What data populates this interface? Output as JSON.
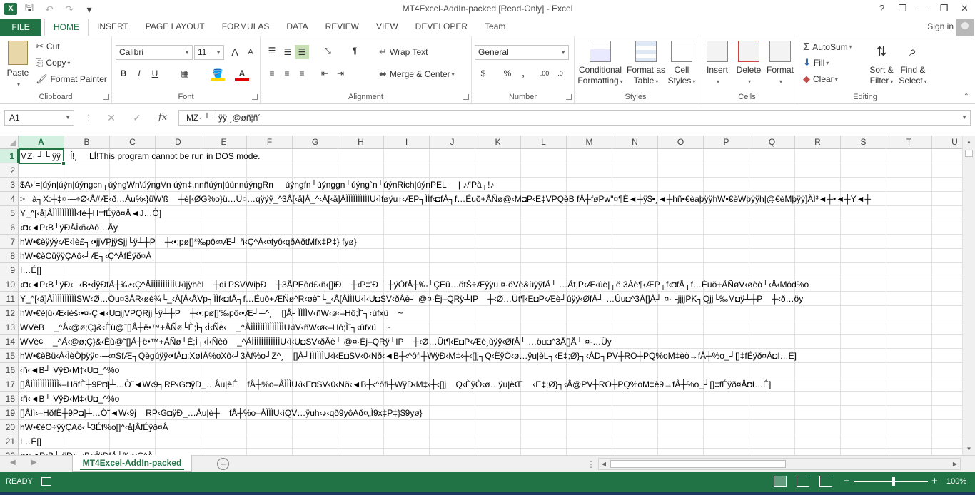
{
  "app": {
    "title": "MT4Excel-AddIn-packed  [Read-Only] - Excel",
    "logo": "X",
    "quick_access": [
      "save-icon",
      "undo-icon",
      "redo-icon",
      "customize-qat-icon"
    ],
    "window_controls": [
      "?",
      "❐",
      "—",
      "❐",
      "✕"
    ]
  },
  "tabs": {
    "file": "FILE",
    "items": [
      "HOME",
      "INSERT",
      "PAGE LAYOUT",
      "FORMULAS",
      "DATA",
      "REVIEW",
      "VIEW",
      "DEVELOPER",
      "Team"
    ],
    "active": "HOME",
    "sign_in": "Sign in"
  },
  "ribbon": {
    "clipboard": {
      "label": "Clipboard",
      "paste": "Paste",
      "cut": "Cut",
      "copy": "Copy",
      "format_painter": "Format Painter"
    },
    "font": {
      "label": "Font",
      "name": "Calibri",
      "size": "11",
      "bold": "B",
      "italic": "I",
      "underline": "U",
      "grow": "A",
      "shrink": "A"
    },
    "alignment": {
      "label": "Alignment",
      "wrap_text": "Wrap Text",
      "merge_center": "Merge & Center"
    },
    "number": {
      "label": "Number",
      "format": "General",
      "currency": "$",
      "percent": "%",
      "comma": ",",
      "inc_decimal": ".00",
      "dec_decimal": ".0"
    },
    "styles": {
      "label": "Styles",
      "conditional_formatting": [
        "Conditional",
        "Formatting"
      ],
      "format_as_table": [
        "Format as",
        "Table"
      ],
      "cell_styles": [
        "Cell",
        "Styles"
      ]
    },
    "cells": {
      "label": "Cells",
      "insert": "Insert",
      "delete": "Delete",
      "format": "Format"
    },
    "editing": {
      "label": "Editing",
      "autosum": "AutoSum",
      "fill": "Fill",
      "clear": "Clear",
      "sort_filter": [
        "Sort &",
        "Filter"
      ],
      "find_select": [
        "Find &",
        "Select"
      ]
    }
  },
  "formula_bar": {
    "name_box": "A1",
    "cancel": "✕",
    "enter": "✓",
    "fx": "fx",
    "value": "MZ· ┘└ ÿÿ ¸@øñ¦ñ´"
  },
  "grid": {
    "columns": [
      "A",
      "B",
      "C",
      "D",
      "E",
      "F",
      "G",
      "H",
      "I",
      "J",
      "K",
      "L",
      "M",
      "N",
      "O",
      "P",
      "Q",
      "R",
      "S",
      "T",
      "U"
    ],
    "active_column": "A",
    "active_row": "1",
    "rows": [
      {
        "n": "1",
        "text": "MZ· ┘└ ÿÿ    ĺ!¸     LÍ!This program cannot be run in DOS mode."
      },
      {
        "n": "2",
        "text": ""
      },
      {
        "n": "3",
        "text": "$A›‘=|úýn|úýn|úýngcn┬úýngWn\\úýngVn úýn‡,nnñúýn|úünnúýngRn     úýngfn┘úýnggn┘úýng`n┘úýnRich|úýnPEL     | ♪/'Pà┐!♪"
      },
      {
        "n": "4",
        "text": ">   à┐X:┼‡¤·─÷Ø‹Å#Æ‹ð…Åu%‹}üW'ß    ┼è[‹ØG%o}ü…Ü¤…qÿÿÿ_^3Å[‹å]Å_^‹Å[‹å]ÅÌÌÌÌÌÌÌÌÌÌU‹ìføÿu↑‹ÆP┐ÌÌf‹◘fÅ┐f…Éuõ+ÅÑø@‹M◘P‹E‡VPQèB fÅ┼føPw\"¤¶È◄┼ÿ$•¸◄┼hñ•€èaþÿÿhW•€èWþÿÿh|@€èMþÿÿ]ÃÌ³◄┼•◄┼Ÿ◄┼"
      },
      {
        "n": "5",
        "text": "Y_^[‹å]ÅÌÌÌÌÌÌÌÌÌÌ‹fè┼H‡fÉÿð¤Å◄J…Ò]"
      },
      {
        "n": "6",
        "text": "‹◘‹◄P‹B┘ÿÐÅÌ‹ñ‹Aô…Åy"
      },
      {
        "n": "7",
        "text": "hW•€èÿÿý‹Æ‹ìè£┐‹•jjVPjÿSjj└ÿ┴┼P    ┼‹•;pø[]*‰pô‹¤Æ┘ ñ‹Ç^Å‹¤fyô‹qðAðtMfx‡P‡} fyø}"
      },
      {
        "n": "8",
        "text": "hW•€èCüÿÿÇAô‹┘Æ┐‹Ç^ÅfÉÿð¤Å"
      },
      {
        "n": "9",
        "text": "I…É[]"
      },
      {
        "n": "10",
        "text": "‹◘‹◄P‹B┘ÿÐ‹┬‹B•‹ÌÿÐfÅ┼‰•‹Ç^ÅÌÌÌÌÌÌÌÌÌÌU‹ìjÿhèl    ┼di PSVWiþÐ    ┼3ÅPEôd£‹ñ‹[]iÐ    ┼‹P‡'Ð    ┼ÿÒfÅ┼‰└ÇEü…ötŠ÷Æÿÿu ¤·öVè&üÿÿfÅ┘ …Åt,P‹Æ‹ûè|┐ë 3Àè¶‹ÆP┐f‹◘fÅ┐f…Éuõ+ÅÑøV‹øèò└‹Å‹Môd%o"
      },
      {
        "n": "11",
        "text": "Y_^[‹å]ÅÌÌÌÌÌÌÌÌÌÌSW‹Ø…Òu¤3ÅR‹øè¾└_‹Å[Å‹ÅVp┐ÌÌf‹◘fÅ┐f…Éuõ+ÆÑø^R‹øè˜└_‹Å[ÅÌÌÌU‹ì‹U◘SV‹ðÅè┘ @¤·Èj–QRÿ┴IP    ┼‹Ø…Üt¶‹E◘P‹Æè┘ûÿÿ‹ØfÅ┘ …Ûu◘^3Å[]Å┘ ¤·└jjjjPK┐Qjj└‰M◘ÿ┴┼P    ┼‹ð…öy"
      },
      {
        "n": "12",
        "text": "hW•€è|ú‹Æ‹ìèš‹•¤·Ç◄‹U◘jjVPQRjj└ÿ┴┼P    ┼‹•;pø[]'‰pô‹•Æ┘─^¸    []Å┘ÌÌÌÌV‹ñW‹ø‹–Hô;Ì˜┐‹ùfxü    ~"
      },
      {
        "n": "13",
        "text": "WVèB    _^Å‹@ø;Ç}&‹Èù@˜[]Å┼ë•™+ÅÑø└È;Ì┐‹Ì‹Ñè‹    _^ÅÌÌÌÌÌÌÌÌÌÌÌÌÌÌU‹ìV‹ñW‹ø‹–Hô;Ì˜┐‹ùfxü    ~"
      },
      {
        "n": "14",
        "text": "WVè¢    _^Å‹@ø;Ç}&‹Èù@˜[]Å┼ë•™+ÅÑø└È;Ì┐‹Ì‹Ñèò    _^ÅÌÌÌÌÌÌÌÌÌÌÌÌU‹ì‹U◘SV‹ðÅè┘ @¤·Èj–QRÿ┴IP    ┼‹Ø…Üt¶‹E◘P‹Æè¸ùÿÿ‹ØfÅ┘ …öu◘^3Å[]Å┘ ¤·…Ûy"
      },
      {
        "n": "15",
        "text": "hW•€èBü‹Å‹ÌèÒþÿÿ¤·─‹¤SfÆ┐Qègúÿÿ‹•fÅ◘;XøÌÅ%oXô‹┘3Åf%o┘Z^¸    []Å┘ÌÌÌÌÌÌU‹ì‹E◘SV‹0‹Nð‹◄B┼‹^ôfi┼WÿÐ‹M‡‹┼‹[]j┐Q‹ÈÿÒ‹ø…ÿu|èL┐‹E‡;Ø}┐‹ÅD┐PV┼RO┼PQ%oM‡èò→fÅ┼%o_┘[]‡fÉÿð¤Å◘I…É]"
      },
      {
        "n": "16",
        "text": "‹ñ‹◄B┘ VÿÐ‹M‡‹U◘_^%o"
      },
      {
        "n": "17",
        "text": "[]ÅÌÌÌÌÌÌÌÌÌÌÌÌ‹–HðfÈ┼9P◘]┴…Ò˜◄W‹9┐RP‹G◘ÿÐ_…Åu|èÉ    fÅ┼%o–ÅÌÌÌU‹ì‹E◘SV‹0‹Nð‹◄B┼‹^ôfi┼WÿÐ‹M‡‹┼‹[]j    Q‹ÈÿÒ‹ø…ÿu|èŒ    ‹E‡;Ø}┐‹Å@PV┼RO┼PQ%oM‡è9→fÅ┼%o_┘[]‡fÉÿð¤Å◘I…É]"
      },
      {
        "n": "18",
        "text": "‹ñ‹◄B┘ VÿÐ‹M‡‹U◘_^%o"
      },
      {
        "n": "19",
        "text": "[]ÅÌì‹–HðfÈ┼9P◘]┴…Ò˜◄W‹9j    RP‹G◘ÿÐ_…Åu|è┼    fÅ┼%o–ÅÌÌÌU‹ìQV…ÿuh‹♪‹qð9yôAð¤„Ì9x‡P‡}$9yø}"
      },
      {
        "n": "20",
        "text": "hW•€èO÷ÿÿÇAô‹└3Éf%o[]^‹å]ÅfÉÿð¤Å"
      },
      {
        "n": "21",
        "text": "I…É[]"
      },
      {
        "n": "22",
        "text": "‹◘‹◄P‹B┘ ÿÐ‹┬‹B•‹ÌÿÐfÅ┼‰•‹Ç^Å"
      }
    ]
  },
  "sheets": {
    "active": "MT4Excel-AddIn-packed"
  },
  "status": {
    "text": "READY",
    "zoom": "100%"
  }
}
